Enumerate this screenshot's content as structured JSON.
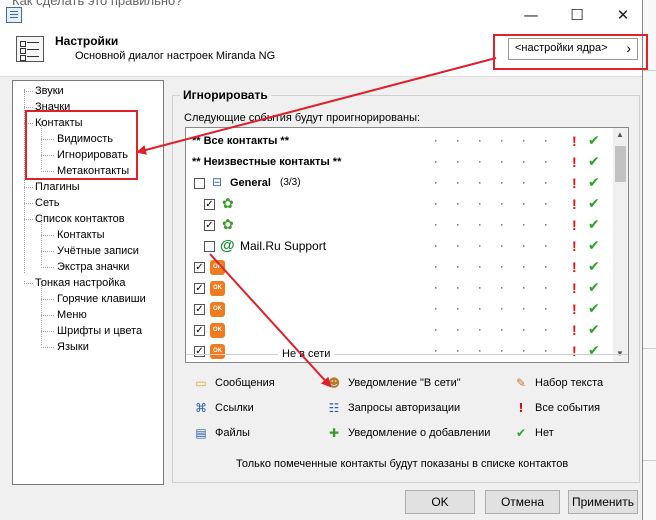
{
  "window": {
    "title_partial": "Как сделать это правильно?",
    "min": "—",
    "max": "☐",
    "close": "✕"
  },
  "header": {
    "title": "Настройки",
    "subtitle": "Основной диалог настроек Miranda NG",
    "profile_select": "<настройки ядра>",
    "profile_arrow": "›"
  },
  "tree": [
    {
      "label": "Звуки"
    },
    {
      "label": "Значки"
    },
    {
      "label": "Контакты"
    },
    {
      "label": "Видимость"
    },
    {
      "label": "Игнорировать"
    },
    {
      "label": "Метаконтакты"
    },
    {
      "label": "Плагины"
    },
    {
      "label": "Сеть"
    },
    {
      "label": "Список контактов"
    },
    {
      "label": "Контакты"
    },
    {
      "label": "Учётные записи"
    },
    {
      "label": "Экстра значки"
    },
    {
      "label": "Тонкая настройка"
    },
    {
      "label": "Горячие клавиши"
    },
    {
      "label": "Меню"
    },
    {
      "label": "Шрифты и цвета"
    },
    {
      "label": "Языки"
    }
  ],
  "panel": {
    "group_title": "Игнорировать",
    "list_caption": "Следующие события будут проигнорированы:",
    "rows": [
      {
        "label": "** Все контакты **"
      },
      {
        "label": "** Неизвестные контакты **"
      },
      {
        "label": "General",
        "count": "(3/3)",
        "toggle": "⊟"
      },
      {
        "label": ""
      },
      {
        "label": ""
      },
      {
        "label": "Mail.Ru Support"
      },
      {
        "label": ""
      },
      {
        "label": ""
      },
      {
        "label": ""
      },
      {
        "label": ""
      },
      {
        "label": ""
      }
    ],
    "ok_badge": "OK",
    "group_separator": "Не в сети",
    "events": [
      {
        "label": "Сообщения",
        "icon": "speech-bubble-icon"
      },
      {
        "label": "Уведомление \"В сети\"",
        "icon": "person-online-icon"
      },
      {
        "label": "Набор текста",
        "icon": "pencil-icon"
      },
      {
        "label": "Ссылки",
        "icon": "url-icon"
      },
      {
        "label": "Запросы авторизации",
        "icon": "auth-request-icon"
      },
      {
        "label": "Все события",
        "icon": "exclamation-icon"
      },
      {
        "label": "Файлы",
        "icon": "file-icon"
      },
      {
        "label": "Уведомление о добавлении",
        "icon": "added-notify-icon"
      },
      {
        "label": "Нет",
        "icon": "checkmark-icon"
      }
    ],
    "footer_note": "Только помеченные контакты будут показаны в списке контактов"
  },
  "buttons": {
    "ok": "OK",
    "cancel": "Отмена",
    "apply": "Применить"
  },
  "colors": {
    "annotation_red": "#e0212b",
    "check_green": "#29a329",
    "mark_red": "#d11111",
    "ok_orange": "#f07a1e"
  }
}
